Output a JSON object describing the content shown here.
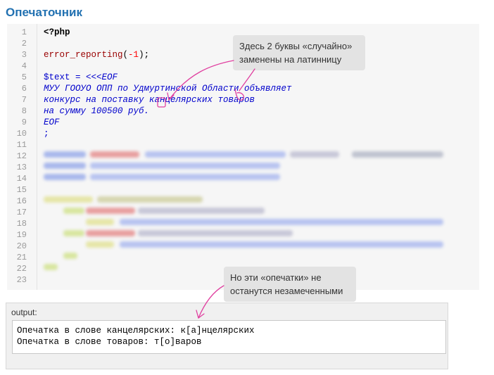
{
  "page": {
    "title": "Опечаточник"
  },
  "code": {
    "line_numbers": [
      "1",
      "2",
      "3",
      "4",
      "5",
      "6",
      "7",
      "8",
      "9",
      "10",
      "11",
      "12",
      "13",
      "14",
      "15",
      "16",
      "17",
      "18",
      "19",
      "20",
      "21",
      "22",
      "23"
    ],
    "line1": "<?php",
    "line3_fn": "error_reporting",
    "line3_open": "(",
    "line3_num": "-1",
    "line3_close": ");",
    "line5_var": "$text",
    "line5_op": " = ",
    "line5_heredoc": "<<<EOF",
    "line6": "МУУ ГООУО ОПП по Удмуртинской Области объявляет",
    "line7": "конкурс на поставку канцелярских товаров",
    "line8": "на сумму 100500 руб.",
    "line9": "EOF",
    "line10": ";"
  },
  "callouts": {
    "top_line1": "Здесь 2 буквы «случайно»",
    "top_line2": "заменены на латинницу",
    "bottom_line1": "Но эти «опечатки» не",
    "bottom_line2": "останутся незамеченными"
  },
  "output": {
    "label": "output:",
    "lines": [
      "Опечатка в слове канцелярских: к[а]нцелярских",
      "Опечатка в слове товаров: т[о]варов"
    ]
  },
  "colors": {
    "title": "#2271b1",
    "annotation": "#e040a0",
    "heredoc": "#0000cc"
  }
}
